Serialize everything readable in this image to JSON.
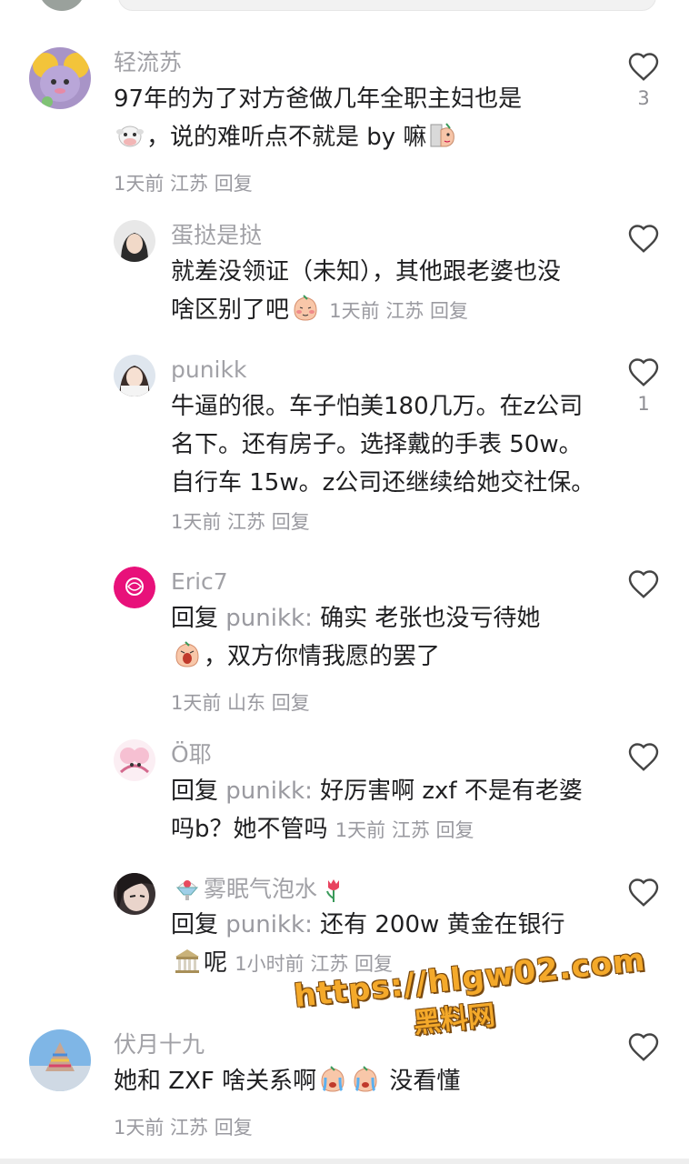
{
  "comments": [
    {
      "user": "轻流苏",
      "text_a": "97年的为了对方爸做几年全职主妇也是",
      "text_b": "，说的难听点不就是 by 嘛",
      "meta": "1天前  江苏  回复",
      "likes": "3"
    },
    {
      "user": "蛋挞是挞",
      "text_a": "就差没领证（未知），其他跟老婆也没",
      "text_b": "啥区别了吧",
      "meta": "1天前  江苏  回复",
      "likes": ""
    },
    {
      "user": "punikk",
      "text": "牛逼的很。车子怕美180几万。在z公司名下。还有房子。选择戴的手表 50w。自行车 15w。z公司还继续给她交社保。",
      "meta": "1天前  江苏  回复",
      "likes": "1"
    },
    {
      "user": "Eric7",
      "reply_prefix": "回复",
      "reply_to": "punikk:",
      "text_a": "确实 老张也没亏待她",
      "text_b": "，双方你情我愿的罢了",
      "meta": "1天前  山东  回复",
      "likes": ""
    },
    {
      "user": "Ö耶",
      "reply_prefix": "回复",
      "reply_to": "punikk:",
      "text": "好厉害啊 zxf 不是有老婆吗b？她不管吗",
      "meta": "1天前  江苏  回复",
      "likes": ""
    },
    {
      "user": "雾眠气泡水",
      "reply_prefix": "回复",
      "reply_to": "punikk:",
      "text_a": "还有 200w 黄金在银行",
      "text_b": "呢",
      "meta": "1小时前  江苏  回复",
      "likes": ""
    },
    {
      "user": "伏月十九",
      "text_a": "她和 ZXF 啥关系啊",
      "text_b": "没看懂",
      "meta": "1天前  江苏  回复",
      "likes": ""
    }
  ],
  "watermark": {
    "url": "https://hlgw02.com",
    "cn": "黑料网"
  },
  "icons": {
    "like": "heart-outline-icon",
    "emoji_cow": "cow-emoji-icon",
    "emoji_shy": "shy-face-emoji-icon",
    "emoji_blush": "blush-face-emoji-icon",
    "emoji_cry": "crying-face-emoji-icon",
    "emoji_bank": "bank-emoji-icon",
    "emoji_tulip": "tulip-emoji-icon",
    "emoji_shaved_ice": "shaved-ice-emoji-icon"
  }
}
